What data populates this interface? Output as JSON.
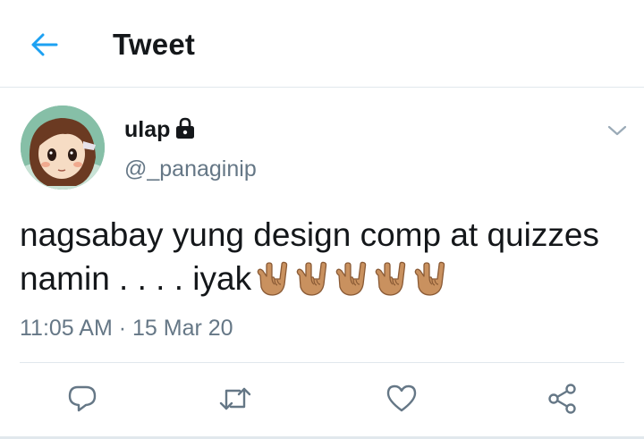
{
  "header": {
    "title": "Tweet",
    "back_icon": "arrow-left-icon"
  },
  "tweet": {
    "display_name": "ulap",
    "handle": "@_panaginip",
    "protected_icon": "lock-icon",
    "text": "nagsabay yung design comp at quizzes namin . . . . iyak",
    "emoji": "🤟🏽",
    "emoji_count": 5,
    "timestamp": "11:05 AM · 15 Mar 20"
  },
  "actions": [
    {
      "name": "reply",
      "icon": "reply-icon"
    },
    {
      "name": "retweet",
      "icon": "retweet-icon"
    },
    {
      "name": "like",
      "icon": "heart-icon"
    },
    {
      "name": "share",
      "icon": "share-icon"
    }
  ],
  "colors": {
    "accent": "#1da1f2",
    "text": "#14171a",
    "secondary": "#657786",
    "border": "#e1e8ed",
    "emoji_skin": "#c9915f"
  }
}
